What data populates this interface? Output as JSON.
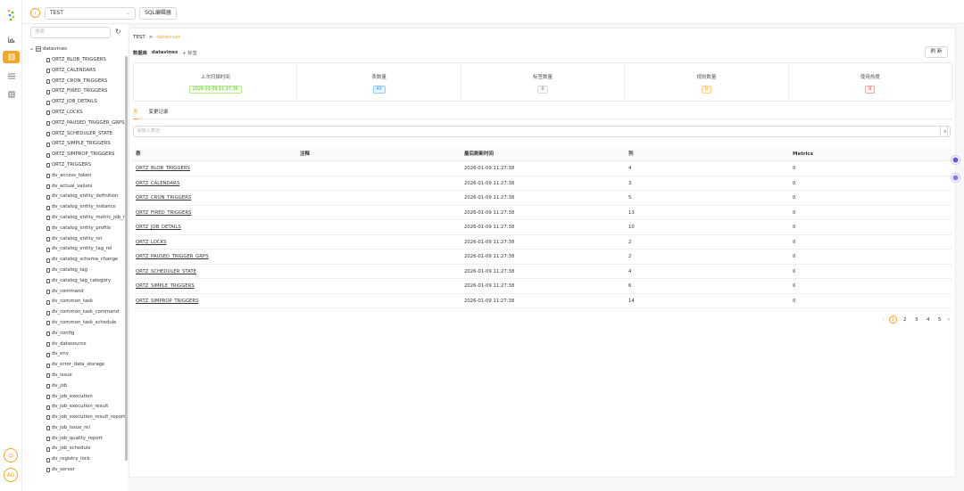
{
  "topbar": {
    "back_icon": "back-arrow-icon",
    "db_select": "TEST",
    "sql_button": "SQL编辑器"
  },
  "sidebar": {
    "nav_icons": [
      "chart-icon",
      "database-icon",
      "list-icon",
      "book-icon"
    ],
    "lang_button": "中",
    "avatar": "AD"
  },
  "tree": {
    "search_placeholder": "搜索",
    "root": "datavines",
    "items": [
      "QRTZ_BLOB_TRIGGERS",
      "QRTZ_CALENDARS",
      "QRTZ_CRON_TRIGGERS",
      "QRTZ_FIRED_TRIGGERS",
      "QRTZ_JOB_DETAILS",
      "QRTZ_LOCKS",
      "QRTZ_PAUSED_TRIGGER_GRPS",
      "QRTZ_SCHEDULER_STATE",
      "QRTZ_SIMPLE_TRIGGERS",
      "QRTZ_SIMPROP_TRIGGERS",
      "QRTZ_TRIGGERS",
      "dv_access_token",
      "dv_actual_values",
      "dv_catalog_entity_definition",
      "dv_catalog_entity_instance",
      "dv_catalog_entity_metric_job_rel",
      "dv_catalog_entity_profile",
      "dv_catalog_entity_rel",
      "dv_catalog_entity_tag_rel",
      "dv_catalog_schema_change",
      "dv_catalog_tag",
      "dv_catalog_tag_category",
      "dv_command",
      "dv_common_task",
      "dv_common_task_command",
      "dv_common_task_schedule",
      "dv_config",
      "dv_datasource",
      "dv_env",
      "dv_error_data_storage",
      "dv_issue",
      "dv_job",
      "dv_job_execution",
      "dv_job_execution_result",
      "dv_job_execution_result_report_rel",
      "dv_job_issue_rel",
      "dv_job_quality_report",
      "dv_job_schedule",
      "dv_registry_lock",
      "dv_server"
    ]
  },
  "main": {
    "breadcrumb": [
      "TEST",
      "datavines"
    ],
    "db_label": "数据库",
    "db_name": "datavines",
    "add_tag": "+ 标签",
    "refresh_button": "刷 新",
    "stats": [
      {
        "label": "上次扫描时间",
        "value": "2026-01-09 11:27:36",
        "style": "green"
      },
      {
        "label": "表数量",
        "value": "40",
        "style": "blue"
      },
      {
        "label": "标签数量",
        "value": "0",
        "style": "gray"
      },
      {
        "label": "规则数量",
        "value": "0",
        "style": "orange"
      },
      {
        "label": "使用热度",
        "value": "0",
        "style": "red"
      }
    ],
    "tabs": [
      "表",
      "变更记录"
    ],
    "search_placeholder": "请输入表名",
    "table": {
      "headers": [
        "表",
        "注释",
        "最后刷新时间",
        "列",
        "Metrics"
      ],
      "rows": [
        [
          "QRTZ_BLOB_TRIGGERS",
          "",
          "2026-01-09 11:27:38",
          "4",
          "0"
        ],
        [
          "QRTZ_CALENDARS",
          "",
          "2026-01-09 11:27:38",
          "3",
          "0"
        ],
        [
          "QRTZ_CRON_TRIGGERS",
          "",
          "2026-01-09 11:27:38",
          "5",
          "0"
        ],
        [
          "QRTZ_FIRED_TRIGGERS",
          "",
          "2026-01-09 11:27:38",
          "13",
          "0"
        ],
        [
          "QRTZ_JOB_DETAILS",
          "",
          "2026-01-09 11:27:38",
          "10",
          "0"
        ],
        [
          "QRTZ_LOCKS",
          "",
          "2026-01-09 11:27:38",
          "2",
          "0"
        ],
        [
          "QRTZ_PAUSED_TRIGGER_GRPS",
          "",
          "2026-01-09 11:27:38",
          "2",
          "0"
        ],
        [
          "QRTZ_SCHEDULER_STATE",
          "",
          "2026-01-09 11:27:38",
          "4",
          "0"
        ],
        [
          "QRTZ_SIMPLE_TRIGGERS",
          "",
          "2026-01-09 11:27:38",
          "6",
          "0"
        ],
        [
          "QRTZ_SIMPROP_TRIGGERS",
          "",
          "2026-01-09 11:27:38",
          "14",
          "0"
        ]
      ]
    },
    "pagination": {
      "pages": [
        "1",
        "2",
        "3",
        "4",
        "5"
      ],
      "current": "1"
    }
  },
  "colors": {
    "accent": "#f5a623"
  }
}
